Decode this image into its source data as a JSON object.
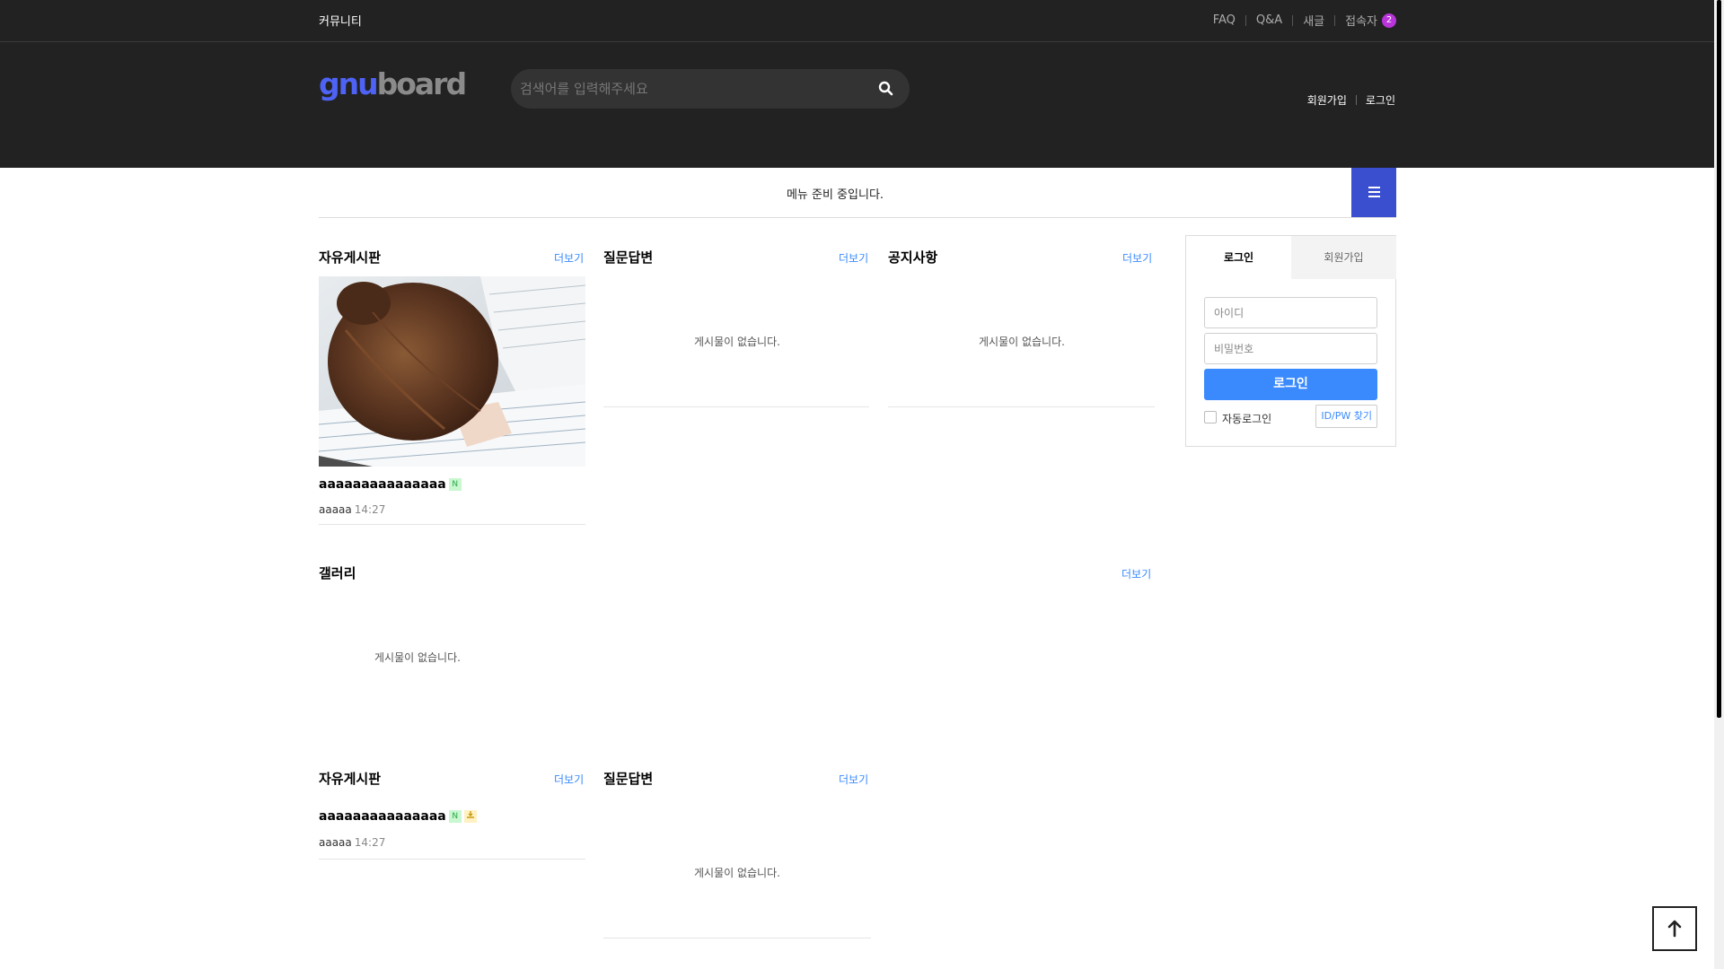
{
  "topbar": {
    "site_name": "커뮤니티",
    "links": {
      "faq": "FAQ",
      "qa": "Q&A",
      "new_posts": "새글",
      "visitors": "접속자",
      "visitor_count": "2"
    }
  },
  "header": {
    "logo": {
      "part1": "gnu",
      "part2": "board"
    },
    "search_placeholder": "검색어를 입력해주세요",
    "search_icon": "search-icon",
    "join": "회원가입",
    "login": "로그인"
  },
  "gnb": {
    "message": "메뉴 준비 중입니다.",
    "menu_icon": "hamburger-icon"
  },
  "sections": {
    "free_board_1": {
      "title": "자유게시판",
      "more": "더보기",
      "post": {
        "title": "aaaaaaaaaaaaaaa",
        "new_badge": "N",
        "author": "aaaaa",
        "time": "14:27"
      }
    },
    "qa_1": {
      "title": "질문답변",
      "more": "더보기",
      "empty": "게시물이 없습니다."
    },
    "notice": {
      "title": "공지사항",
      "more": "더보기",
      "empty": "게시물이 없습니다."
    },
    "gallery": {
      "title": "갤러리",
      "more": "더보기",
      "empty": "게시물이 없습니다."
    },
    "free_board_2": {
      "title": "자유게시판",
      "more": "더보기",
      "post": {
        "title": "aaaaaaaaaaaaaaa",
        "new_badge": "N",
        "file_badge": "file-icon",
        "author": "aaaaa",
        "time": "14:27"
      }
    },
    "qa_2": {
      "title": "질문답변",
      "more": "더보기",
      "empty": "게시물이 없습니다."
    }
  },
  "login_box": {
    "tab_login": "로그인",
    "tab_join": "회원가입",
    "id_placeholder": "아이디",
    "pw_placeholder": "비밀번호",
    "submit": "로그인",
    "auto_login": "자동로그인",
    "find": "ID/PW 찾기"
  },
  "colors": {
    "header_bg": "#222222",
    "accent_blue": "#3a8afd",
    "menu_blue": "#3a4ed0",
    "logo_blue": "#4e63f5",
    "badge_purple": "#b934d9"
  }
}
